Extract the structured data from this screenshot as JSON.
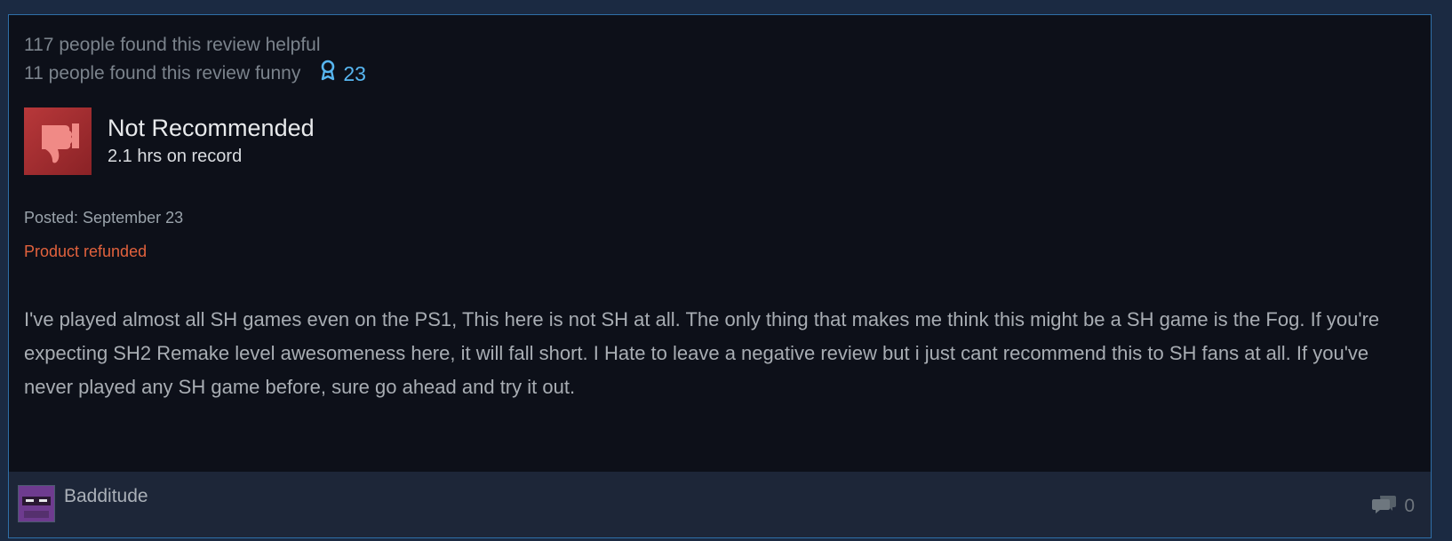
{
  "review": {
    "helpful_text": "117 people found this review helpful",
    "funny_text": "11 people found this review funny",
    "award_count": "23",
    "verdict": "Not Recommended",
    "hours": "2.1 hrs on record",
    "posted": "Posted: September 23",
    "refunded": "Product refunded",
    "body": "I've played almost all SH games even on the PS1, This here is not SH at all. The only thing that makes me think this might be a SH game is the Fog. If you're expecting SH2 Remake level awesomeness here, it will fall short. I Hate to leave a negative review but i just cant recommend this to SH fans at all. If you've never played any SH game before, sure go ahead and try it out."
  },
  "author": {
    "username": "Badditude"
  },
  "comments": {
    "count": "0"
  },
  "icons": {
    "award": "award-ribbon-icon",
    "thumb": "thumbs-down-icon",
    "comment": "comment-bubbles-icon"
  },
  "colors": {
    "card_bg": "#0d1019",
    "border": "#2f6fa8",
    "refunded": "#e2623d",
    "award": "#57b6f0",
    "thumb_bg": "#b8383a"
  }
}
